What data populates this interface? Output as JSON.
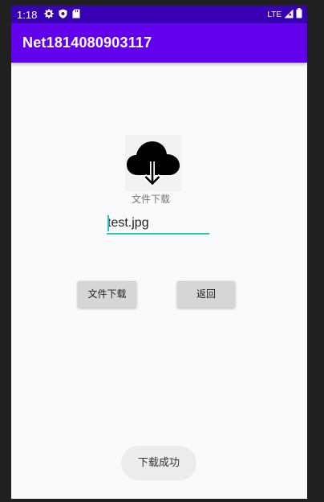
{
  "status_bar": {
    "time": "1:18",
    "network": "LTE",
    "icons": [
      "gear-icon",
      "shield-icon",
      "sd-card-icon",
      "signal-icon",
      "battery-icon"
    ]
  },
  "app_bar": {
    "title": "Net1814080903117"
  },
  "main": {
    "cloud_icon": "cloud-download-icon",
    "cloud_caption": "文件下载",
    "filename_input": {
      "value": "test.jpg",
      "placeholder": ""
    },
    "download_button_label": "文件下载",
    "back_button_label": "返回"
  },
  "toast": {
    "message": "下载成功"
  },
  "colors": {
    "status_bar": "#3700b3",
    "app_bar": "#6200ee",
    "input_accent": "#26c6bf",
    "button_bg": "#d6d6d6"
  }
}
